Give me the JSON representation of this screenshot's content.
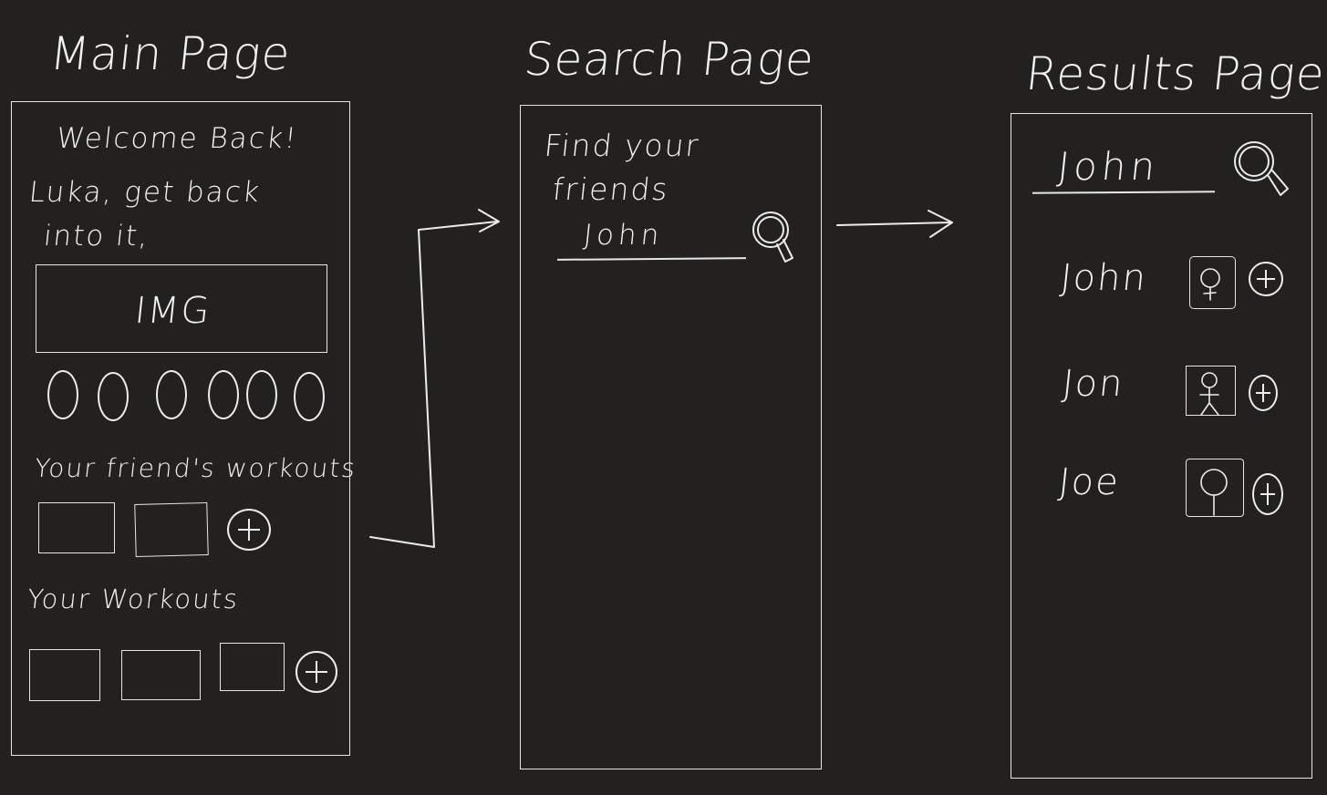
{
  "main_page": {
    "heading": "Main Page",
    "welcome": "Welcome Back!",
    "greeting_line1": "Luka, get back",
    "greeting_line2": "into it,",
    "img_label": "IMG",
    "friends_workouts_label": "Your friend's workouts",
    "your_workouts_label": "Your Workouts"
  },
  "search_page": {
    "heading": "Search Page",
    "prompt_line1": "Find your",
    "prompt_line2": "friends",
    "query": "John"
  },
  "results_page": {
    "heading": "Results Page",
    "query": "John",
    "results": [
      {
        "name": "John"
      },
      {
        "name": "Jon"
      },
      {
        "name": "Joe"
      }
    ]
  },
  "icons": [
    "search-icon",
    "add-icon",
    "avatar-icon",
    "arrow-icon"
  ]
}
